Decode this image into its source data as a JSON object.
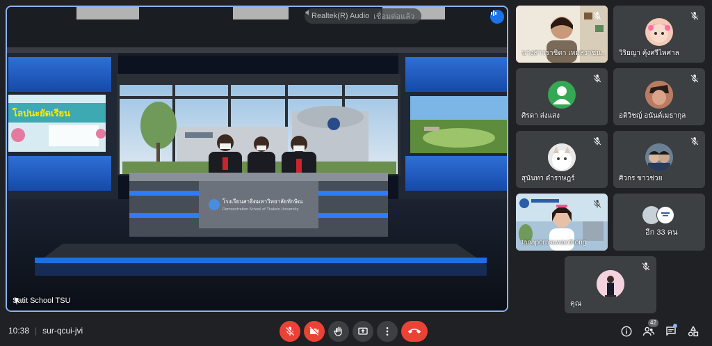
{
  "stage": {
    "audio_banner": "Realtek(R) Audio",
    "audio_sub": "เชื่อมต่อแล้ว",
    "presenter_name": "Satit School TSU",
    "desk_sign": "โรงเรียนสาธิตมหาวิทยาลัยทักษิณ",
    "desk_sign_sub": "Demonstration School of Thaksin University",
    "banner_text": "โลปนะยัดเรียน"
  },
  "participants": [
    {
      "name": "นางสาวราชิดา เหมสงาชน...",
      "muted": true
    },
    {
      "name": "วิริยญา คุ้งศรีไพศาล",
      "muted": true
    },
    {
      "name": "ศิรดา ส่งแสง",
      "muted": true
    },
    {
      "name": "อติวิชญ์ อนันต์เมธากุล",
      "muted": true
    },
    {
      "name": "สุนันทา ดำราษฎร์",
      "muted": true
    },
    {
      "name": "ศิวกร ขาวช่วย",
      "muted": true
    },
    {
      "name": "tanapornsuwanthong",
      "muted": true
    },
    {
      "name": "อีก 33 คน",
      "muted": false
    },
    {
      "name": "คุณ",
      "muted": true
    }
  ],
  "bottom_bar": {
    "time": "10:38",
    "meeting_code": "sur-qcui-jvi",
    "people_count": "42"
  },
  "colors": {
    "background": "#202124",
    "tile": "#3c4043",
    "accent": "#8ab4f8",
    "danger": "#ea4335"
  },
  "icons": {
    "mic_off": "mic-off-icon",
    "camera_off": "camera-off-icon",
    "raise_hand": "hand-icon",
    "present": "present-icon",
    "more": "more-vert-icon",
    "end_call": "end-call-icon",
    "info": "info-icon",
    "people": "people-icon",
    "chat": "chat-icon",
    "activities": "activities-icon"
  }
}
